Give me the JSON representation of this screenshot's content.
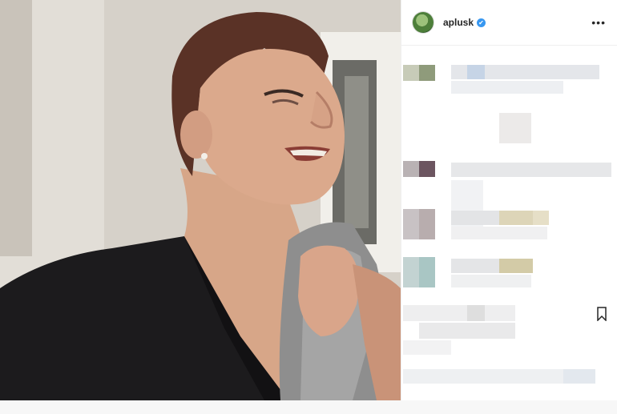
{
  "post": {
    "username": "aplusk",
    "verified_symbol": "✔",
    "more_symbol": "•••"
  },
  "icons": {
    "avatar": "profile-avatar",
    "verified": "verified-badge-icon",
    "more": "more-options-icon",
    "bookmark": "bookmark-icon"
  },
  "colors": {
    "verified_blue": "#3897f0",
    "text_dark": "#262626"
  }
}
